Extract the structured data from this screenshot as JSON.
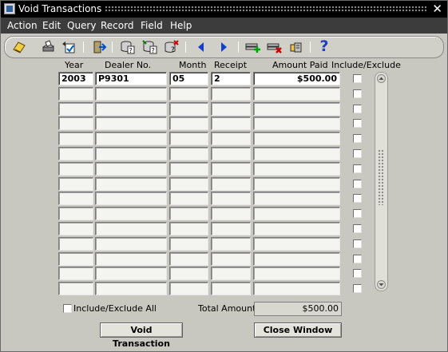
{
  "window": {
    "title": "Void Transactions",
    "close_glyph": "✕"
  },
  "menu": [
    "Action",
    "Edit",
    "Query",
    "Record",
    "Field",
    "Help"
  ],
  "toolbar": {
    "help_glyph": "?",
    "icons": [
      "save-icon",
      "print-icon",
      "clear-form-icon",
      "exit-icon",
      "enter-query-icon",
      "execute-query-icon",
      "cancel-query-icon",
      "previous-record-icon",
      "next-record-icon",
      "insert-record-icon",
      "delete-record-icon",
      "lock-record-icon",
      "help-icon"
    ]
  },
  "columns": {
    "year": "Year",
    "dealer": "Dealer No.",
    "month": "Month",
    "receipt": "Receipt",
    "amount": "Amount Paid",
    "include": "Include/Exclude"
  },
  "rows": [
    {
      "year": "2003",
      "dealer": "P9301",
      "month": "05",
      "receipt": "2",
      "amount": "$500.00"
    },
    {
      "year": "",
      "dealer": "",
      "month": "",
      "receipt": "",
      "amount": ""
    },
    {
      "year": "",
      "dealer": "",
      "month": "",
      "receipt": "",
      "amount": ""
    },
    {
      "year": "",
      "dealer": "",
      "month": "",
      "receipt": "",
      "amount": ""
    },
    {
      "year": "",
      "dealer": "",
      "month": "",
      "receipt": "",
      "amount": ""
    },
    {
      "year": "",
      "dealer": "",
      "month": "",
      "receipt": "",
      "amount": ""
    },
    {
      "year": "",
      "dealer": "",
      "month": "",
      "receipt": "",
      "amount": ""
    },
    {
      "year": "",
      "dealer": "",
      "month": "",
      "receipt": "",
      "amount": ""
    },
    {
      "year": "",
      "dealer": "",
      "month": "",
      "receipt": "",
      "amount": ""
    },
    {
      "year": "",
      "dealer": "",
      "month": "",
      "receipt": "",
      "amount": ""
    },
    {
      "year": "",
      "dealer": "",
      "month": "",
      "receipt": "",
      "amount": ""
    },
    {
      "year": "",
      "dealer": "",
      "month": "",
      "receipt": "",
      "amount": ""
    },
    {
      "year": "",
      "dealer": "",
      "month": "",
      "receipt": "",
      "amount": ""
    },
    {
      "year": "",
      "dealer": "",
      "month": "",
      "receipt": "",
      "amount": ""
    },
    {
      "year": "",
      "dealer": "",
      "month": "",
      "receipt": "",
      "amount": ""
    }
  ],
  "footer": {
    "include_all_label": "Include/Exclude All",
    "total_label": "Total Amount",
    "total_value": "$500.00",
    "void_button": "Void Transaction",
    "close_button": "Close Window"
  }
}
